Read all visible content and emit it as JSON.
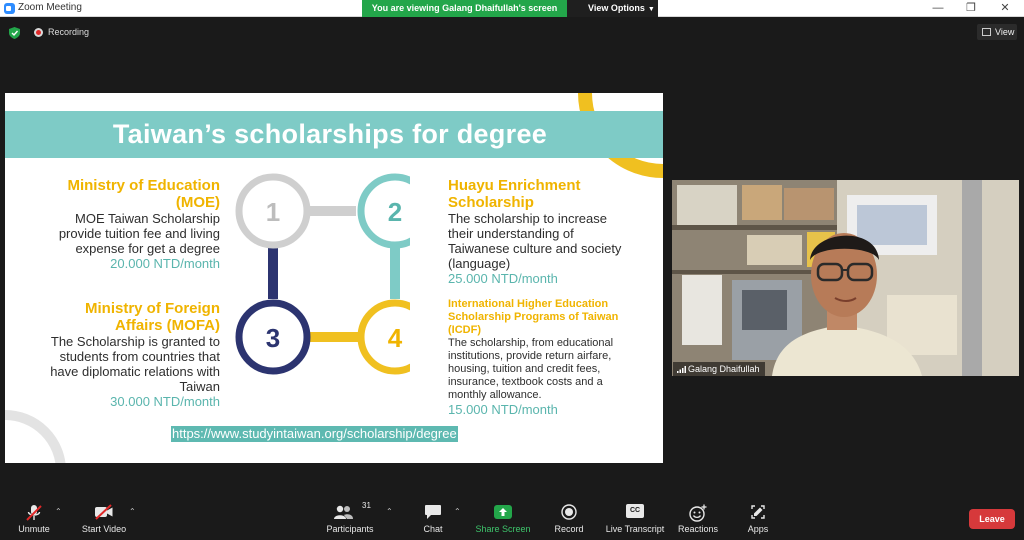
{
  "window": {
    "title": "Zoom Meeting",
    "viewing_banner": "You are viewing Galang Dhaifullah's screen",
    "view_options": "View Options"
  },
  "status": {
    "recording": "Recording",
    "view": "View"
  },
  "slide": {
    "title": "Taiwan’s scholarships for degree",
    "steps": [
      "1",
      "2",
      "3",
      "4"
    ],
    "moe": {
      "org_line1": "Ministry of Education",
      "org_line2": "(MOE)",
      "desc": [
        "MOE Taiwan Scholarship",
        "provide tuition fee and living",
        "expense for get a degree"
      ],
      "amount": "20.000 NTD/month"
    },
    "mofa": {
      "org_line1": "Ministry of Foreign",
      "org_line2": "Affairs (MOFA)",
      "desc": [
        "The Scholarship is granted to",
        "students from countries that",
        "have diplomatic relations with",
        "Taiwan"
      ],
      "amount": "30.000 NTD/month"
    },
    "huayu": {
      "org_line1": "Huayu Enrichment",
      "org_line2": "Scholarship",
      "desc": [
        "The scholarship to increase",
        "their understanding of",
        "Taiwanese culture and society",
        "(language)"
      ],
      "amount": "25.000 NTD/month"
    },
    "icdf": {
      "org": [
        "International Higher Education",
        "Scholarship Programs of Taiwan",
        "(ICDF)"
      ],
      "desc": [
        "The scholarship, from educational",
        "institutions, provide return airfare,",
        "housing, tuition and credit fees,",
        "insurance, textbook costs and a",
        "monthly allowance."
      ],
      "amount": "15.000 NTD/month"
    },
    "link": "https://www.studyintaiwan.org/scholarship/degree"
  },
  "video": {
    "participant_name": "Galang Dhaifullah"
  },
  "toolbar": {
    "unmute": "Unmute",
    "start_video": "Start Video",
    "participants": "Participants",
    "participants_count": "31",
    "chat": "Chat",
    "share_screen": "Share Screen",
    "record": "Record",
    "live_transcript": "Live Transcript",
    "cc": "CC",
    "reactions": "Reactions",
    "apps": "Apps",
    "leave": "Leave"
  },
  "colors": {
    "teal": "#7ecbc6",
    "yellow": "#f0b400",
    "navy": "#2c3470",
    "grey": "#cfcfcf",
    "leave_red": "#d6393b",
    "banner_green": "#23a64a",
    "share_green": "#23a64a"
  }
}
